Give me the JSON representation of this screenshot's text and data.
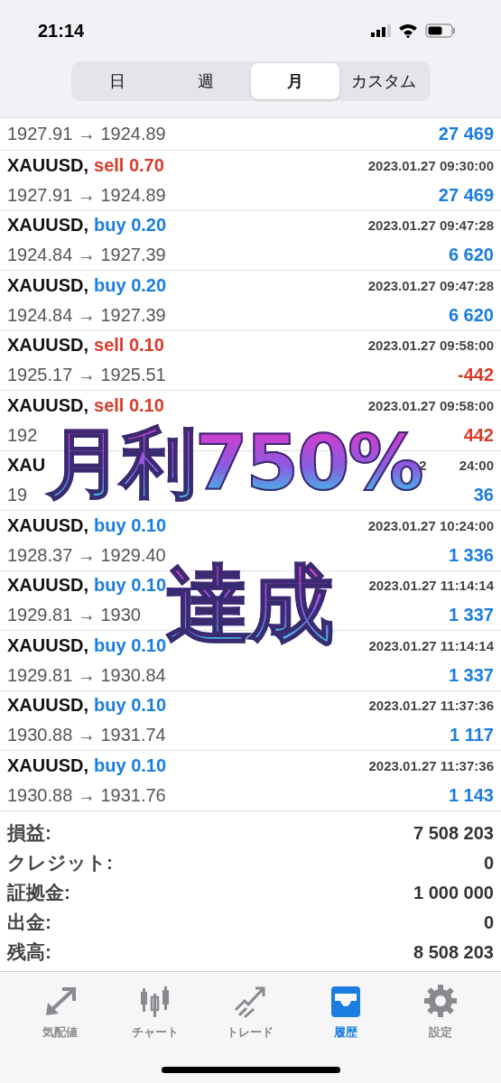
{
  "status_bar": {
    "time": "21:14"
  },
  "period_tabs": [
    {
      "label": "日",
      "selected": false
    },
    {
      "label": "週",
      "selected": false
    },
    {
      "label": "月",
      "selected": true
    },
    {
      "label": "カスタム",
      "selected": false
    }
  ],
  "deals": [
    {
      "prices": "1927.91 → 1924.89",
      "profit": "27 469",
      "loss": false
    },
    {
      "symbol": "XAUUSD,",
      "trade": "sell 0.70",
      "sell": true,
      "time": "2023.01.27 09:30:00",
      "prices": "1927.91 → 1924.89",
      "profit": "27 469",
      "loss": false
    },
    {
      "symbol": "XAUUSD,",
      "trade": "buy 0.20",
      "sell": false,
      "time": "2023.01.27 09:47:28",
      "prices": "1924.84 → 1927.39",
      "profit": "6 620",
      "loss": false
    },
    {
      "symbol": "XAUUSD,",
      "trade": "buy 0.20",
      "sell": false,
      "time": "2023.01.27 09:47:28",
      "prices": "1924.84 → 1927.39",
      "profit": "6 620",
      "loss": false
    },
    {
      "symbol": "XAUUSD,",
      "trade": "sell 0.10",
      "sell": true,
      "time": "2023.01.27 09:58:00",
      "prices": "1925.17 → 1925.51",
      "profit": "-442",
      "loss": true
    },
    {
      "symbol": "XAUUSD,",
      "trade": "sell 0.10",
      "sell": true,
      "time": "2023.01.27 09:58:00",
      "prices": "192",
      "profit": "442",
      "loss": true
    },
    {
      "symbol": "XAU",
      "time": "2",
      "time_end": "24:00",
      "prices": "19",
      "profit": "36",
      "loss": false
    },
    {
      "symbol": "XAUUSD,",
      "trade": "buy 0.10",
      "sell": false,
      "time": "2023.01.27 10:24:00",
      "prices": "1928.37 → 1929.40",
      "profit": "1 336",
      "loss": false
    },
    {
      "symbol": "XAUUSD,",
      "trade": "buy 0.10",
      "sell": false,
      "time": "2023.01.27 11:14:14",
      "prices": "1929.81 → 1930",
      "profit": "1 337",
      "loss": false
    },
    {
      "symbol": "XAUUSD,",
      "trade": "buy 0.10",
      "sell": false,
      "time": "2023.01.27 11:14:14",
      "prices": "1929.81 → 1930.84",
      "profit": "1 337",
      "loss": false
    },
    {
      "symbol": "XAUUSD,",
      "trade": "buy 0.10",
      "sell": false,
      "time": "2023.01.27 11:37:36",
      "prices": "1930.88 → 1931.74",
      "profit": "1 117",
      "loss": false
    },
    {
      "symbol": "XAUUSD,",
      "trade": "buy 0.10",
      "sell": false,
      "time": "2023.01.27 11:37:36",
      "prices": "1930.88 → 1931.76",
      "profit": "1 143",
      "loss": false
    }
  ],
  "overlay": {
    "lines": [
      "月利750%",
      "達成"
    ]
  },
  "summary": [
    {
      "label": "損益:",
      "value": "7 508 203"
    },
    {
      "label": "クレジット:",
      "value": "0"
    },
    {
      "label": "証拠金:",
      "value": "1 000 000"
    },
    {
      "label": "出金:",
      "value": "0"
    },
    {
      "label": "残高:",
      "value": "8 508 203"
    }
  ],
  "bottom_tabs": [
    {
      "kind": "quotes",
      "label": "気配値",
      "selected": false
    },
    {
      "kind": "chart",
      "label": "チャート",
      "selected": false
    },
    {
      "kind": "trade",
      "label": "トレード",
      "selected": false
    },
    {
      "kind": "history",
      "label": "履歴",
      "selected": true
    },
    {
      "kind": "settings",
      "label": "設定",
      "selected": false
    }
  ]
}
